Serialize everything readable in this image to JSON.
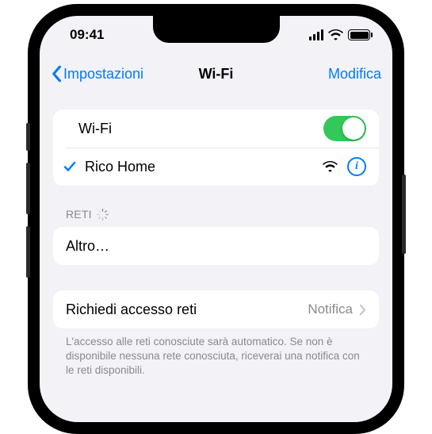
{
  "status": {
    "time": "09:41"
  },
  "nav": {
    "back": "Impostazioni",
    "title": "Wi-Fi",
    "edit": "Modifica"
  },
  "wifi": {
    "label": "Wi-Fi",
    "enabled": true,
    "connected": {
      "name": "Rico Home"
    }
  },
  "networks": {
    "header": "RETI",
    "other": "Altro…"
  },
  "ask": {
    "label": "Richiedi accesso reti",
    "value": "Notifica",
    "footer": "L'accesso alle reti conosciute sarà automatico. Se non è disponibile nessuna rete conosciuta, riceverai una notifica con le reti disponibili."
  }
}
